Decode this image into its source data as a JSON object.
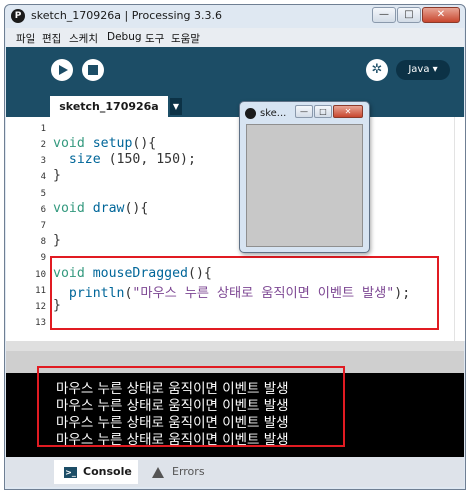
{
  "window": {
    "title": "sketch_170926a | Processing 3.3.6",
    "controls": {
      "minimize": "—",
      "maximize": "□",
      "close": "✕"
    }
  },
  "menu": [
    "파일",
    "편집",
    "스케치",
    "Debug",
    "도구",
    "도움말"
  ],
  "toolbar": {
    "run_icon": "play-icon",
    "stop_icon": "stop-icon",
    "debug_icon": "butterfly-icon",
    "mode_label": "Java ▾"
  },
  "tab": {
    "name": "sketch_170926a",
    "menu_glyph": "▼"
  },
  "editor": {
    "line_numbers": [
      "1",
      "2",
      "3",
      "4",
      "5",
      "6",
      "7",
      "8",
      "9",
      "10",
      "11",
      "12",
      "13"
    ],
    "setup_kw": "void",
    "setup_fn": "setup",
    "setup_rest": "(){",
    "size_fn": "size",
    "size_args": " (150, 150);",
    "brace": "}",
    "draw_kw": "void",
    "draw_fn": "draw",
    "draw_rest": "(){",
    "drag_kw": "void",
    "drag_fn": "mouseDragged",
    "drag_rest": "(){",
    "println_fn": "println",
    "println_open": "(",
    "println_str": "\"마우스 누른 상태로 움직이면 이벤트 발생\"",
    "println_close": ");"
  },
  "sketch_window": {
    "title": "ske..."
  },
  "console": {
    "lines": [
      "마우스 누른 상태로 움직이면 이벤트 발생",
      "마우스 누른 상태로 움직이면 이벤트 발생",
      "마우스 누른 상태로 움직이면 이벤트 발생",
      "마우스 누른 상태로 움직이면 이벤트 발생"
    ]
  },
  "status_tabs": {
    "console": "Console",
    "errors": "Errors"
  },
  "colors": {
    "toolbar_bg": "#1c4d66",
    "keyword": "#33997e",
    "function": "#006699",
    "string": "#7d4793",
    "highlight": "#e11b22"
  }
}
